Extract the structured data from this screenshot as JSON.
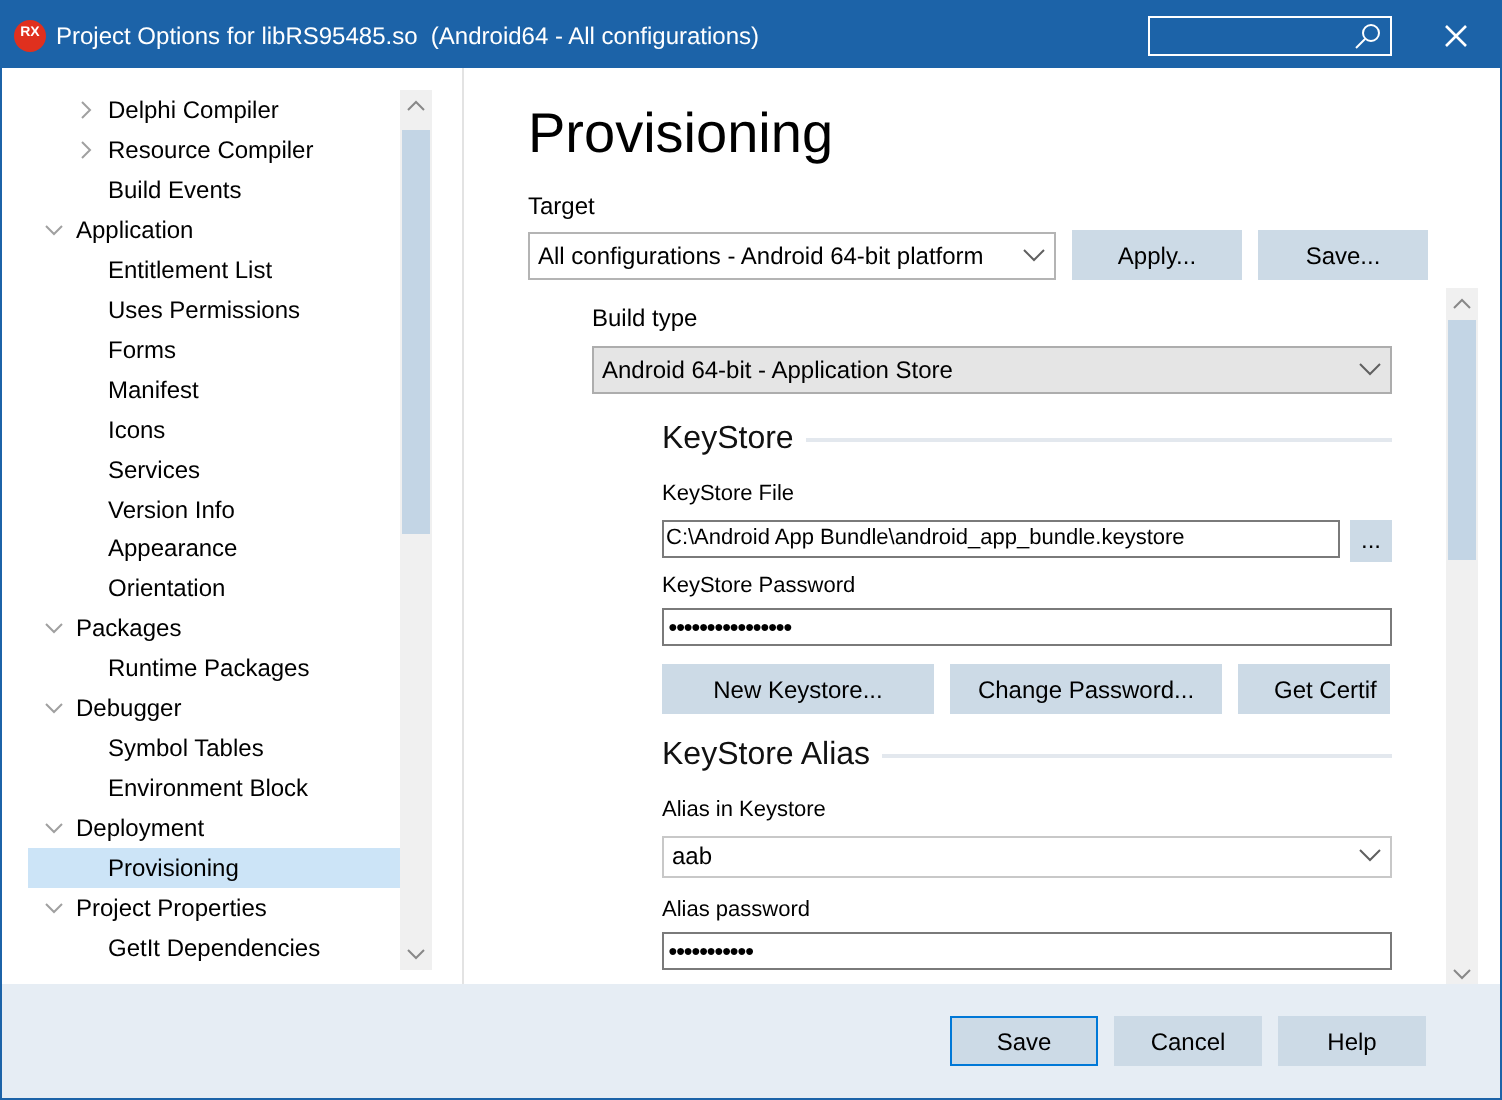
{
  "window": {
    "title": "Project Options for libRS95485.so  (Android64 - All configurations)",
    "logo": "RX"
  },
  "tree": {
    "continued_items": [
      {
        "label": "Delphi Compiler",
        "expanded": false,
        "selected": false
      },
      {
        "label": "Resource Compiler",
        "expanded": false,
        "selected": false
      },
      {
        "label": "Build Events",
        "selected": false
      }
    ],
    "items": [
      {
        "label": "Application",
        "expanded": true,
        "selected": false,
        "children": [
          {
            "label": "Entitlement List",
            "selected": false
          },
          {
            "label": "Uses Permissions",
            "selected": false
          },
          {
            "label": "Forms",
            "selected": false
          },
          {
            "label": "Manifest",
            "selected": false
          },
          {
            "label": "Icons",
            "selected": false
          },
          {
            "label": "Services",
            "selected": false
          },
          {
            "label": "Version Info",
            "selected": false
          },
          {
            "label": "Appearance",
            "selected": false
          },
          {
            "label": "Orientation",
            "selected": false
          }
        ]
      },
      {
        "label": "Packages",
        "expanded": true,
        "selected": false,
        "children": [
          {
            "label": "Runtime Packages",
            "selected": false
          }
        ]
      },
      {
        "label": "Debugger",
        "expanded": true,
        "selected": false,
        "children": [
          {
            "label": "Symbol Tables",
            "selected": false
          },
          {
            "label": "Environment Block",
            "selected": false
          }
        ]
      },
      {
        "label": "Deployment",
        "expanded": true,
        "selected": false,
        "children": [
          {
            "label": "Provisioning",
            "selected": true
          }
        ]
      },
      {
        "label": "Project Properties",
        "expanded": true,
        "selected": false,
        "children": [
          {
            "label": "GetIt Dependencies",
            "selected": false
          }
        ]
      }
    ]
  },
  "page": {
    "title": "Provisioning",
    "target": {
      "label": "Target",
      "value": "All configurations - Android 64-bit platform",
      "buttons": [
        "Apply...",
        "Save..."
      ]
    },
    "build_type": {
      "label": "Build type",
      "value": "Android 64-bit - Application Store"
    },
    "keystore": {
      "heading": "KeyStore",
      "file_label": "KeyStore File",
      "file_value": "C:\\Android App Bundle\\android_app_bundle.keystore",
      "browse": "...",
      "password_label": "KeyStore Password",
      "password_value": "●●●●●●●●●●●●●●●●",
      "buttons": [
        "New Keystore...",
        "Change Password...",
        "Get Certif"
      ]
    },
    "alias": {
      "heading": "KeyStore Alias",
      "alias_label": "Alias in Keystore",
      "alias_value": "aab",
      "password_label": "Alias password",
      "password_value": "●●●●●●●●●●●"
    }
  },
  "footer": {
    "buttons": [
      {
        "label": "Save",
        "focused": true
      },
      {
        "label": "Cancel",
        "focused": false
      },
      {
        "label": "Help",
        "focused": false
      }
    ]
  }
}
